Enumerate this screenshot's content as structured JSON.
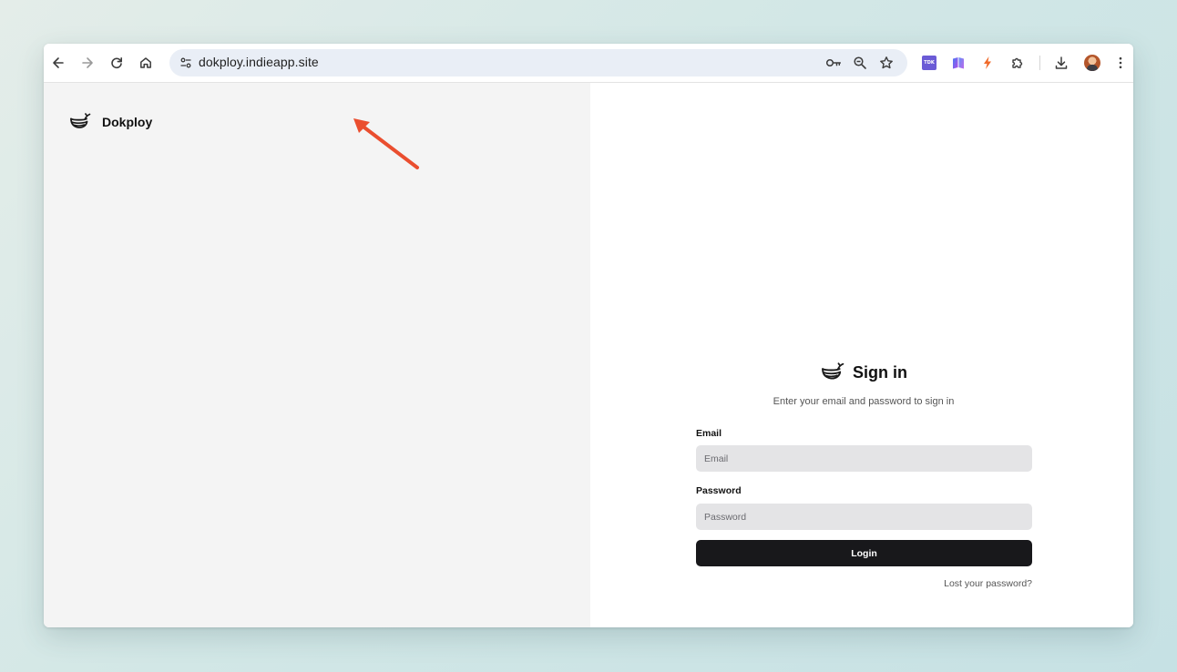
{
  "browser": {
    "url": "dokploy.indieapp.site",
    "extensions": {
      "tdk_label": "TDK"
    },
    "icons": {
      "back": "arrow-left-icon",
      "forward": "arrow-right-icon",
      "reload": "reload-icon",
      "home": "home-icon",
      "site_info": "tune-icon",
      "password": "key-icon",
      "zoom": "zoom-out-icon",
      "bookmark": "star-icon",
      "extensions": "puzzle-icon",
      "downloads": "download-icon",
      "menu": "more-vertical-icon"
    }
  },
  "sidebar": {
    "brand_name": "Dokploy"
  },
  "signin": {
    "title": "Sign in",
    "subtitle": "Enter your email and password to sign in",
    "email_label": "Email",
    "email_placeholder": "Email",
    "password_label": "Password",
    "password_placeholder": "Password",
    "login_label": "Login",
    "lost_password": "Lost your password?"
  },
  "colors": {
    "accent_button": "#18181b",
    "annotation_arrow": "#ea4e2f",
    "left_panel_bg": "#f4f4f4",
    "input_bg": "#e4e4e6"
  }
}
